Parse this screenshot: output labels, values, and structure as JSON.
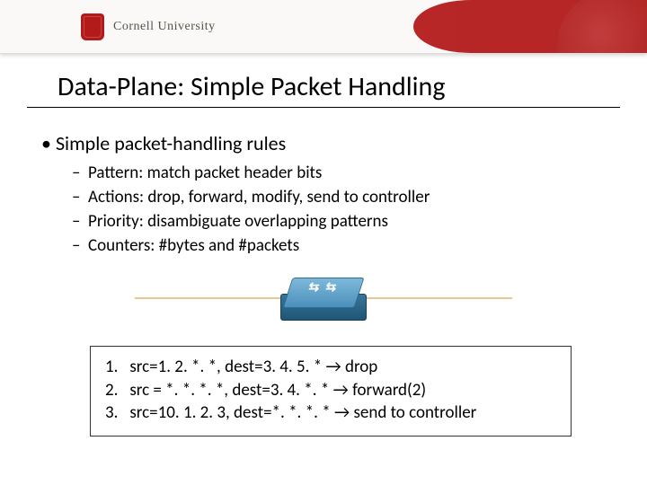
{
  "banner": {
    "wordmark": "Cornell University"
  },
  "title": "Data-Plane: Simple Packet Handling",
  "bullets": {
    "l1": "Simple packet-handling rules",
    "l2": [
      "Pattern: match packet header bits",
      "Actions: drop, forward, modify, send to controller",
      "Priority: disambiguate overlapping patterns",
      "Counters: #bytes and #packets"
    ]
  },
  "rules": [
    "1.   src=1. 2. *. *, dest=3. 4. 5. * → drop",
    "2.   src = *. *. *. *, dest=3. 4. *. * → forward(2)",
    "3.   src=10. 1. 2. 3, dest=*. *. *. * → send to controller"
  ]
}
